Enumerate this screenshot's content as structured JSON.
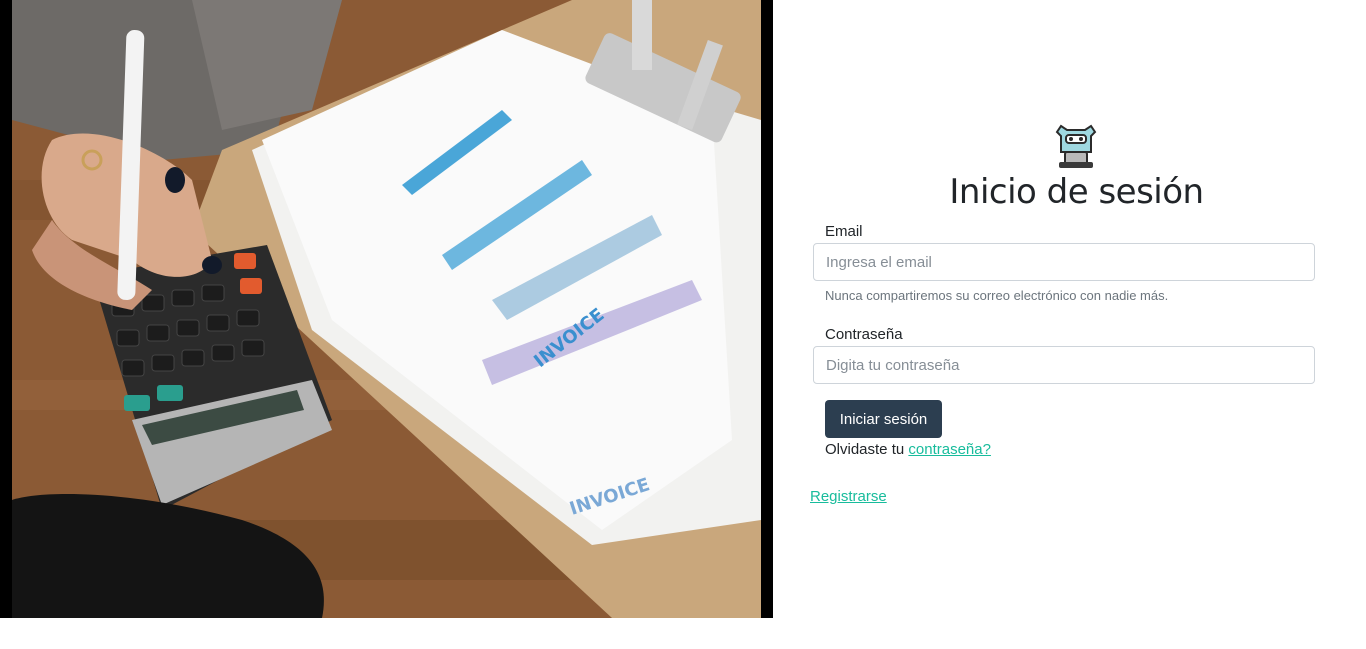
{
  "photo": {
    "alt_icon": "invoice-calculator-photo"
  },
  "logo": {
    "icon": "robot-icon"
  },
  "form": {
    "title": "Inicio de sesión",
    "email_label": "Email",
    "email_placeholder": "Ingresa el email",
    "email_value": "",
    "email_help": "Nunca compartiremos su correo electrónico con nadie más.",
    "password_label": "Contraseña",
    "password_placeholder": "Digita tu contraseña",
    "password_value": "",
    "submit_label": "Iniciar sesión",
    "forgot_text": "Olvidaste tu",
    "forgot_link": "contraseña?",
    "register_link": "Registrarse"
  },
  "colors": {
    "primary": "#2c3e50",
    "link": "#18bc9c",
    "frame": "#000000"
  }
}
